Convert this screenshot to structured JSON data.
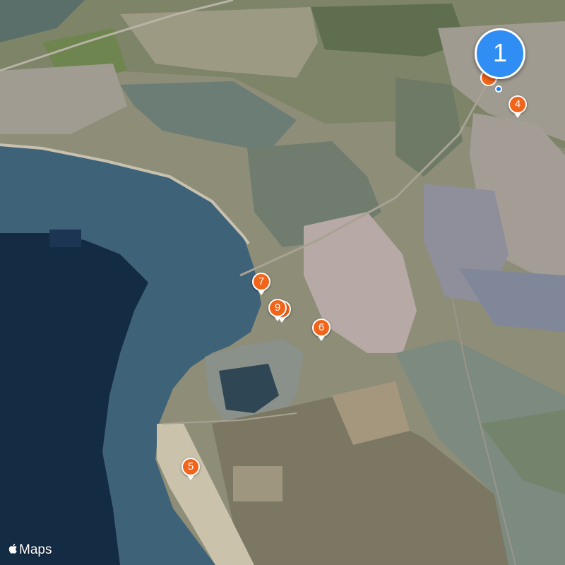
{
  "map": {
    "type": "satellite",
    "attribution": "Maps",
    "attribution_icon": "apple-logo-icon",
    "cluster": {
      "label": "1",
      "color": "#2f8df3"
    },
    "pin_color": "#f2641a",
    "pins": [
      {
        "id": "4",
        "label": "4"
      },
      {
        "id": "5",
        "label": "5"
      },
      {
        "id": "6",
        "label": "6"
      },
      {
        "id": "7",
        "label": "7"
      },
      {
        "id": "8",
        "label": "8"
      },
      {
        "id": "9",
        "label": "9"
      }
    ]
  }
}
